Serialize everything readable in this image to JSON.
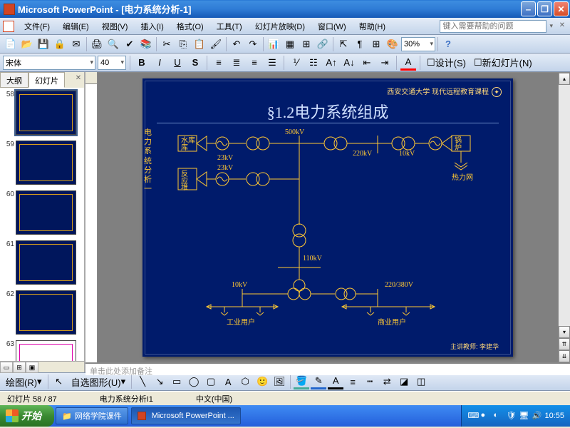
{
  "titlebar": {
    "app": "Microsoft PowerPoint",
    "doc": "[电力系统分析-1]"
  },
  "menus": {
    "file": "文件(F)",
    "edit": "编辑(E)",
    "view": "视图(V)",
    "insert": "插入(I)",
    "format": "格式(O)",
    "tools": "工具(T)",
    "slideshow": "幻灯片放映(D)",
    "window": "窗口(W)",
    "help": "帮助(H)"
  },
  "help_placeholder": "键入需要帮助的问题",
  "zoom": "30%",
  "font": {
    "name": "宋体",
    "size": "40"
  },
  "format_links": {
    "design": "设计(S)",
    "newslide": "新幻灯片(N)"
  },
  "outline": {
    "tab_outline": "大纲",
    "tab_slides": "幻灯片",
    "thumbs": [
      "58",
      "59",
      "60",
      "61",
      "62",
      "63"
    ]
  },
  "notes_placeholder": "单击此处添加备注",
  "draw": {
    "label": "绘图(R)",
    "autoshape": "自选图形(U)"
  },
  "status": {
    "slide": "幻灯片 58 / 87",
    "design": "电力系统分析I1",
    "lang": "中文(中国)"
  },
  "taskbar": {
    "start": "开始",
    "item1": "网络学院课件",
    "item2": "Microsoft PowerPoint ...",
    "clock": "10:55"
  },
  "slide": {
    "header": "西安交通大学 现代远程教育课程",
    "title": "§1.2电力系统组成",
    "footer": "主讲教师: 李建华",
    "sidelabel": "电力系统分析一",
    "labels": {
      "hydro": "水库",
      "reactor": "反应堆",
      "boiler": "锅炉",
      "heatnet": "热力网",
      "v500": "500kV",
      "v220": "220kV",
      "v23a": "23kV",
      "v23b": "23kV",
      "v10": "10kV",
      "v110": "110kV",
      "v10b": "10kV",
      "v220_380": "220/380V",
      "industrial": "工业用户",
      "commercial": "商业用户"
    }
  }
}
